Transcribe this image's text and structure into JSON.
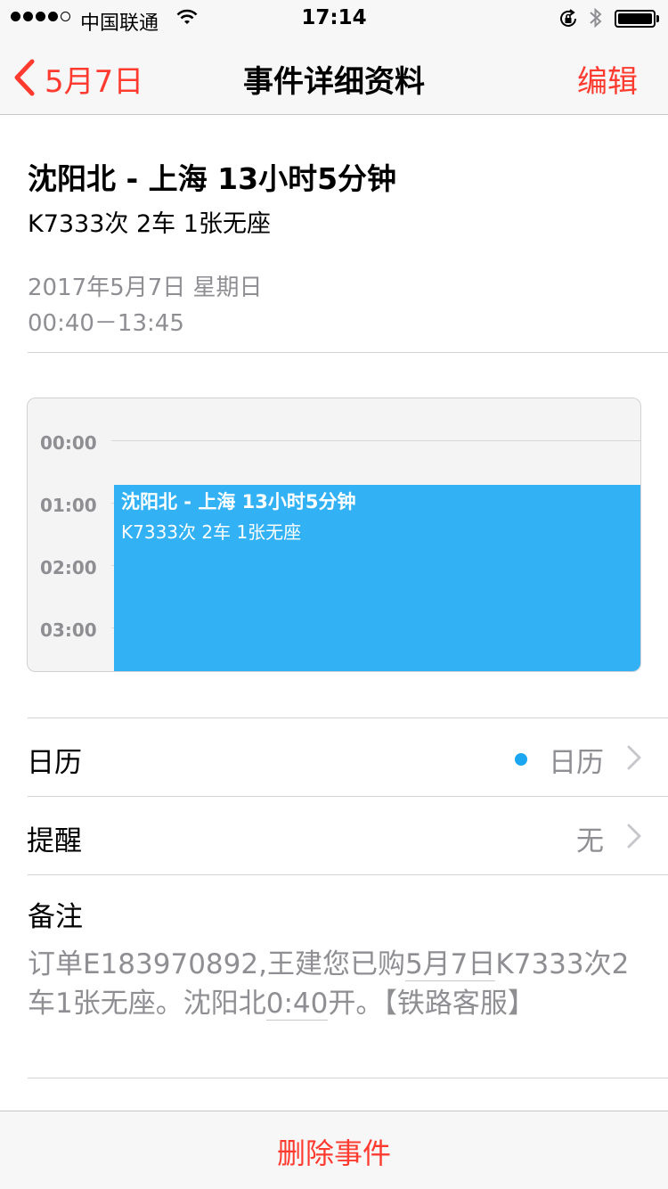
{
  "status_bar": {
    "carrier": "中国联通",
    "time": "17:14",
    "signal_bars": 4,
    "signal_total": 5
  },
  "nav": {
    "back_label": "5月7日",
    "title": "事件详细资料",
    "edit_label": "编辑"
  },
  "event": {
    "title": "沈阳北 - 上海 13小时5分钟",
    "subtitle": "K7333次 2车 1张无座",
    "date": "2017年5月7日 星期日",
    "time_range": "00:40－13:45"
  },
  "preview": {
    "hours": [
      "00:00",
      "01:00",
      "02:00",
      "03:00"
    ],
    "event_title": "沈阳北 - 上海 13小时5分钟",
    "event_subtitle": "K7333次 2车 1张无座",
    "event_color": "#32b2f5"
  },
  "rows": {
    "calendar": {
      "label": "日历",
      "value": "日历",
      "dot_color": "#1aa6f0"
    },
    "alert": {
      "label": "提醒",
      "value": "无"
    }
  },
  "notes": {
    "label": "备注",
    "part1": "订单E183970892,王建您已购",
    "link_date": "5月7日",
    "part2": "K7333次2车1张无座。沈阳北",
    "link_time": "0:40",
    "part3": "开。【铁路客服】"
  },
  "bottom": {
    "delete_label": "删除事件"
  },
  "colors": {
    "accent": "#ff3b30",
    "secondary_text": "#8e8e93"
  }
}
